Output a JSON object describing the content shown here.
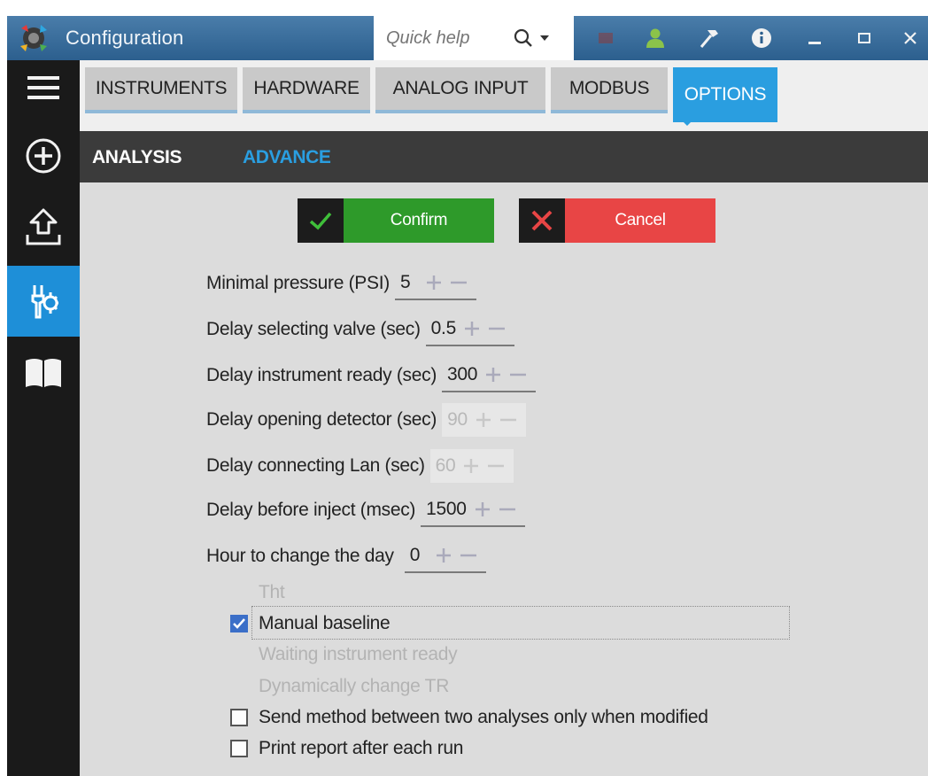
{
  "window": {
    "title": "Configuration",
    "quick_help_placeholder": "Quick help",
    "title_icons": [
      "flag-icon",
      "user-icon",
      "hammer-icon",
      "info-icon",
      "minimize-icon",
      "maximize-icon",
      "close-icon"
    ]
  },
  "rail": {
    "items": [
      {
        "icon": "menu-icon",
        "active": false
      },
      {
        "icon": "add-icon",
        "active": false
      },
      {
        "icon": "upload-icon",
        "active": false
      },
      {
        "icon": "settings-tools-icon",
        "active": true
      },
      {
        "icon": "book-icon",
        "active": false
      }
    ]
  },
  "tabs": [
    {
      "label": "INSTRUMENTS",
      "active": false
    },
    {
      "label": "HARDWARE",
      "active": false
    },
    {
      "label": "ANALOG INPUT",
      "active": false
    },
    {
      "label": "MODBUS",
      "active": false
    },
    {
      "label": "OPTIONS",
      "active": true
    }
  ],
  "subtabs": [
    {
      "label": "ANALYSIS",
      "active": true
    },
    {
      "label": "ADVANCE",
      "active": false
    }
  ],
  "actions": {
    "confirm_label": "Confirm",
    "cancel_label": "Cancel"
  },
  "fields": [
    {
      "label": "Minimal pressure (PSI)",
      "value": "5",
      "enabled": true
    },
    {
      "label": "Delay selecting valve (sec)",
      "value": "0.5",
      "enabled": true
    },
    {
      "label": "Delay instrument ready (sec)",
      "value": "300",
      "enabled": true
    },
    {
      "label": "Delay opening detector (sec)",
      "value": "90",
      "enabled": false
    },
    {
      "label": "Delay connecting Lan (sec)",
      "value": "60",
      "enabled": false
    },
    {
      "label": "Delay before inject (msec)",
      "value": "1500",
      "enabled": true
    },
    {
      "label": "Hour to change the day",
      "value": "0",
      "enabled": true
    }
  ],
  "options": [
    {
      "label": "Tht",
      "checked": false,
      "enabled": false
    },
    {
      "label": "Manual baseline",
      "checked": true,
      "enabled": true
    },
    {
      "label": "Waiting instrument ready",
      "checked": false,
      "enabled": false
    },
    {
      "label": "Dynamically change TR",
      "checked": false,
      "enabled": false
    },
    {
      "label": "Send method between two analyses only when modified",
      "checked": false,
      "enabled": true
    },
    {
      "label": "Print report after each run",
      "checked": false,
      "enabled": true
    }
  ],
  "colors": {
    "titlebar": "#2c5f8e",
    "accent": "#2a9ee0",
    "confirm": "#2e9a2a",
    "cancel": "#e84545",
    "rail": "#1a1a1a",
    "checkbox_checked": "#3b6fc8"
  }
}
